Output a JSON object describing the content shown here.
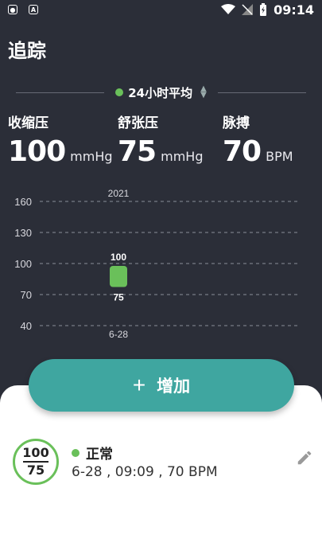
{
  "status_bar": {
    "time": "09:14",
    "icons": [
      "notification-icon",
      "a-icon",
      "wifi-icon",
      "signal-off-icon",
      "battery-charging-icon"
    ]
  },
  "header": {
    "title": "追踪"
  },
  "range_selector": {
    "label": "24小时平均",
    "dot_color": "#6ac05a"
  },
  "metrics": {
    "systolic": {
      "label": "收缩压",
      "value": "100",
      "unit": "mmHg"
    },
    "diastolic": {
      "label": "舒张压",
      "value": "75",
      "unit": "mmHg"
    },
    "pulse": {
      "label": "脉搏",
      "value": "70",
      "unit": "BPM"
    }
  },
  "chart_data": {
    "type": "bar",
    "year_label": "2021",
    "categories": [
      "6-28"
    ],
    "series": [
      {
        "values": [
          100
        ],
        "kind": "systolic"
      },
      {
        "values": [
          75
        ],
        "kind": "diastolic"
      }
    ],
    "yticks": [
      160,
      130,
      100,
      70,
      40
    ],
    "ylim": [
      40,
      160
    ],
    "grid": true,
    "bar_color": "#6ac05a"
  },
  "actions": {
    "add_label": "增加"
  },
  "record": {
    "systolic": "100",
    "diastolic": "75",
    "status": "正常",
    "status_color": "#6ac05a",
    "detail": "6-28 , 09:09 , 70 BPM"
  },
  "colors": {
    "background": "#2b2e38",
    "accent": "#3fa6a0",
    "normal": "#6ac05a"
  }
}
